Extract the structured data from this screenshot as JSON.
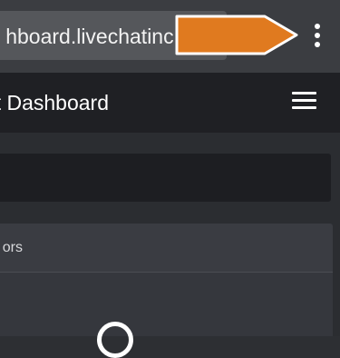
{
  "browser": {
    "url": "hboard.livechatinc.",
    "menu_icon": "more-vertical-icon"
  },
  "annotation": {
    "arrow_color": "#e07a1f",
    "arrow_outline": "#ffffff"
  },
  "header": {
    "title": "t Dashboard",
    "menu_icon": "hamburger-icon"
  },
  "card": {
    "title": "ors"
  },
  "colors": {
    "browser_bar": "#3b3d41",
    "url_field": "#55575b",
    "app_header": "#1f2024",
    "background": "#2d2f33",
    "card": "#3a3c42"
  }
}
